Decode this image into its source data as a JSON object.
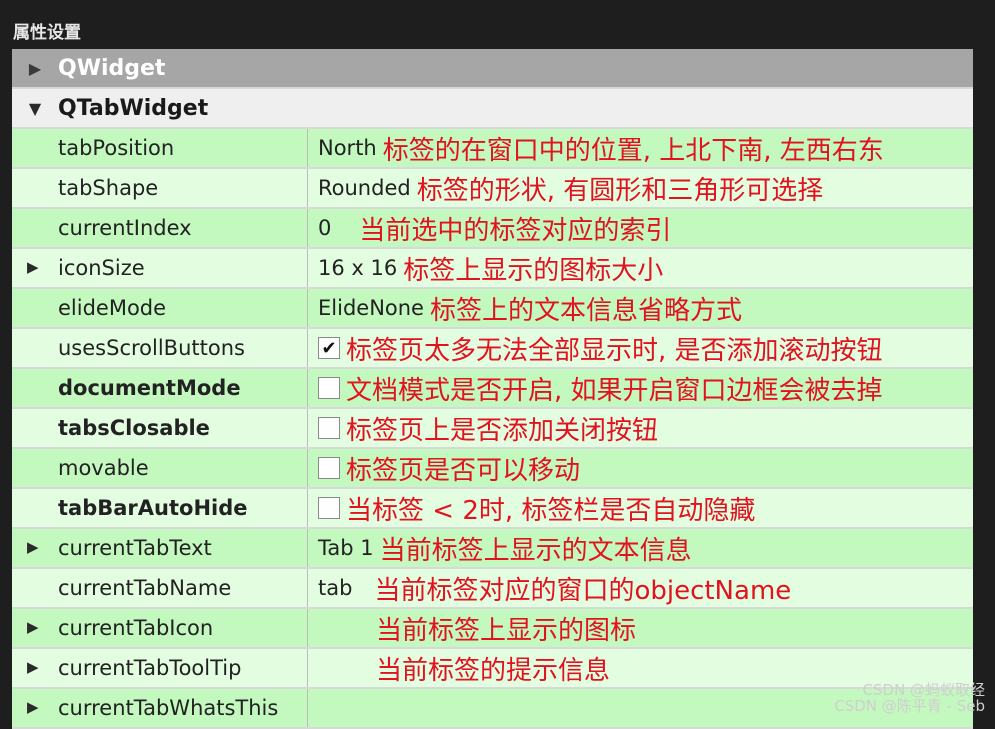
{
  "panel": {
    "title": "属性设置"
  },
  "groups": {
    "qwidget": {
      "label": "QWidget"
    },
    "qtabwidget": {
      "label": "QTabWidget"
    }
  },
  "properties": [
    {
      "name": "tabPosition",
      "value": "North",
      "note": "标签的在窗口中的位置, 上北下南, 左西右东"
    },
    {
      "name": "tabShape",
      "value": "Rounded",
      "note": "标签的形状, 有圆形和三角形可选择"
    },
    {
      "name": "currentIndex",
      "value": "0",
      "note": "当前选中的标签对应的索引"
    },
    {
      "name": "iconSize",
      "value": "16 x 16",
      "note": "标签上显示的图标大小"
    },
    {
      "name": "elideMode",
      "value": "ElideNone",
      "note": "标签上的文本信息省略方式"
    },
    {
      "name": "usesScrollButtons",
      "checked": true,
      "note": "标签页太多无法全部显示时, 是否添加滚动按钮"
    },
    {
      "name": "documentMode",
      "checked": false,
      "note": "文档模式是否开启, 如果开启窗口边框会被去掉"
    },
    {
      "name": "tabsClosable",
      "checked": false,
      "note": "标签页上是否添加关闭按钮"
    },
    {
      "name": "movable",
      "checked": false,
      "note": "标签页是否可以移动"
    },
    {
      "name": "tabBarAutoHide",
      "checked": false,
      "note": "当标签 < 2时, 标签栏是否自动隐藏"
    },
    {
      "name": "currentTabText",
      "value": "Tab 1",
      "note": "当前标签上显示的文本信息"
    },
    {
      "name": "currentTabName",
      "value": "tab",
      "note": "当前标签对应的窗口的objectName"
    },
    {
      "name": "currentTabIcon",
      "value": "",
      "note": "当前标签上显示的图标"
    },
    {
      "name": "currentTabToolTip",
      "value": "",
      "note": "当前标签的提示信息"
    },
    {
      "name": "currentTabWhatsThis",
      "value": "",
      "note": ""
    }
  ],
  "icons": {
    "collapsed": "triangle-right-icon",
    "expanded": "triangle-down-icon",
    "check": "checkmark-icon"
  },
  "checkmark": "✔",
  "watermark": {
    "line1": "CSDN @蚂蚁取经",
    "line2": "CSDN @陈平青 - Seb"
  },
  "colors": {
    "row_light": "#e3fde1",
    "row_dark": "#c3f8bf",
    "note_red": "#e2121e"
  }
}
